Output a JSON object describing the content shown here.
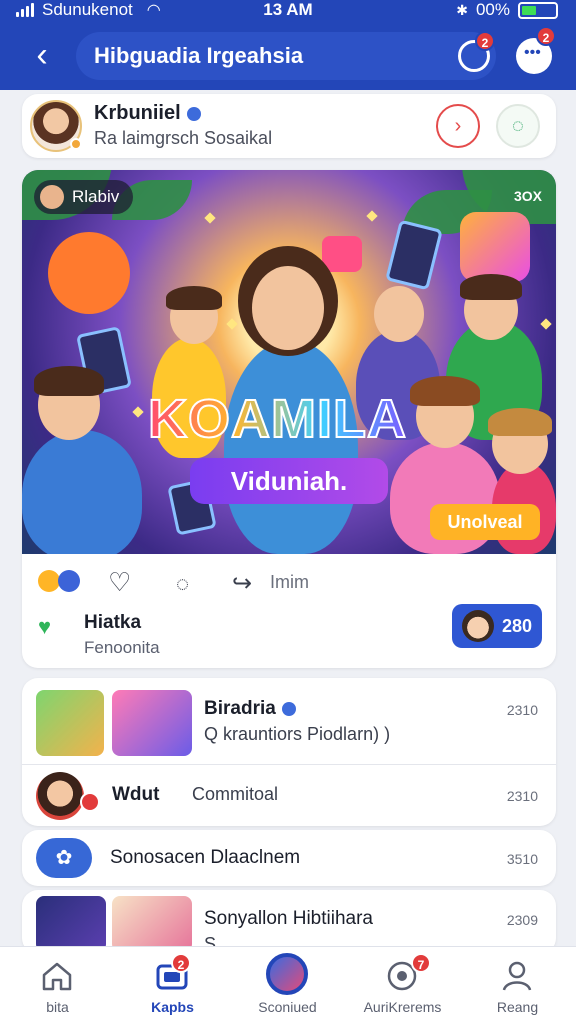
{
  "status_bar": {
    "carrier": "Sdunukenot",
    "time": "13 AM",
    "battery": "00%"
  },
  "header": {
    "title": "Hibguadia Irgeahsia",
    "refresh_badge": "2",
    "chat_badge": "2"
  },
  "profile": {
    "name": "Krbuniiel",
    "subtitle": "Ra laimgrsch Sosaikal"
  },
  "post": {
    "media_tag": "Rlabiv",
    "media_count": "3OX",
    "brand_title": "KOAMILA",
    "brand_subtitle": "Viduniah.",
    "corner_tag": "Unolveal",
    "action_label": "Imim",
    "info_title": "Hiatka",
    "info_subtitle": "Fenoonita",
    "count": "280"
  },
  "feed": [
    {
      "title": "Biradria",
      "subtitle": "Q krauntiors Piodlarn) )",
      "time": "2310"
    },
    {
      "title": "Wdut",
      "subtitle": "Commitoal",
      "time": "2310"
    },
    {
      "title": "Sonosacen Dlaaclnem",
      "time": "3510"
    },
    {
      "title": "Sonyallon Hibtiihara",
      "subtitle": "S",
      "time": "2309"
    }
  ],
  "bottom_nav": [
    {
      "label": "bita",
      "icon": "home-icon",
      "badge": ""
    },
    {
      "label": "Kapbs",
      "icon": "gallery-icon",
      "badge": "2"
    },
    {
      "label": "Sconiued",
      "icon": "compass-icon",
      "badge": ""
    },
    {
      "label": "AuriKrerems",
      "icon": "notification-icon",
      "badge": "7"
    },
    {
      "label": "Reang",
      "icon": "profile-icon",
      "badge": ""
    }
  ],
  "colors": {
    "header": "#2346b8",
    "accent": "#2f57d3",
    "badge": "#e23b3b"
  }
}
